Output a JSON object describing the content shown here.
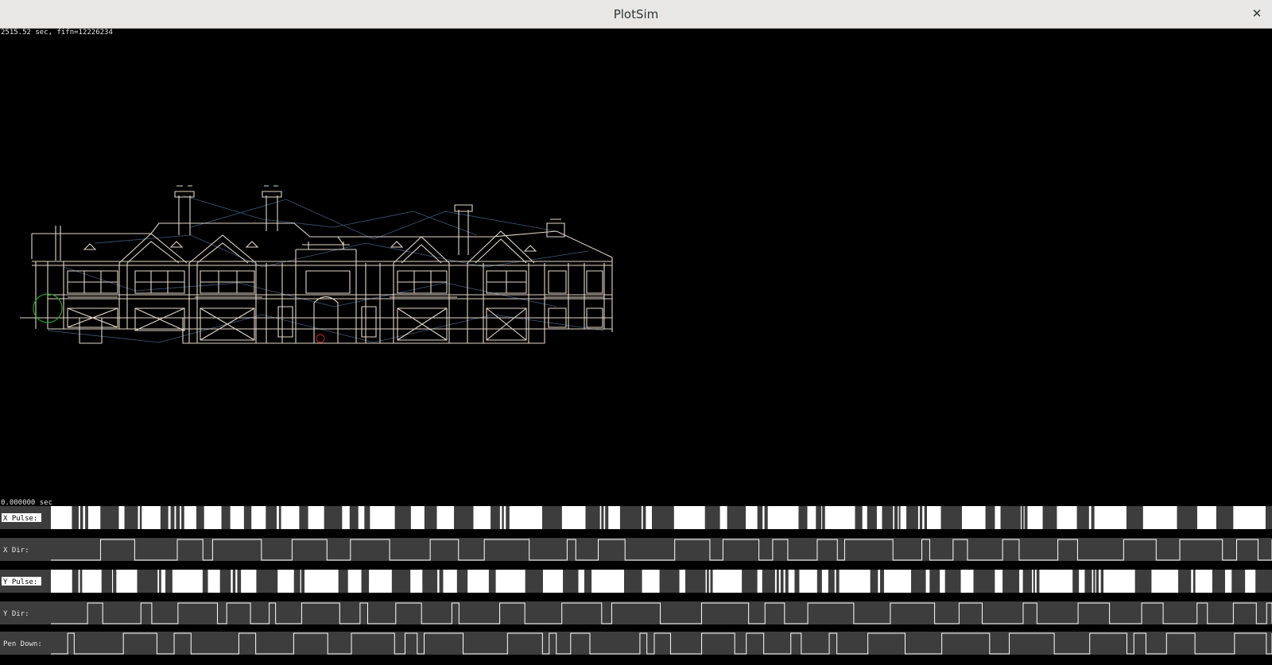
{
  "window": {
    "title": "PlotSim",
    "close_icon": "close-icon"
  },
  "status": {
    "elapsed": "2515.52 sec, fifn=12226234",
    "timeline_time": "0.000000 sec"
  },
  "colors": {
    "drawing": "#e2d6c8",
    "travel": "#4a6a8f",
    "pen_marker": "#1ea01e",
    "head_marker": "#cc2222",
    "trace_fill": "#3d3d3d",
    "pulse": "#ffffff"
  },
  "channels": [
    {
      "name": "X Pulse:",
      "highlighted": true
    },
    {
      "name": "X Dir:",
      "highlighted": false
    },
    {
      "name": "Y Pulse:",
      "highlighted": true
    },
    {
      "name": "Y Dir:",
      "highlighted": false
    },
    {
      "name": "Pen Down:",
      "highlighted": false
    }
  ]
}
